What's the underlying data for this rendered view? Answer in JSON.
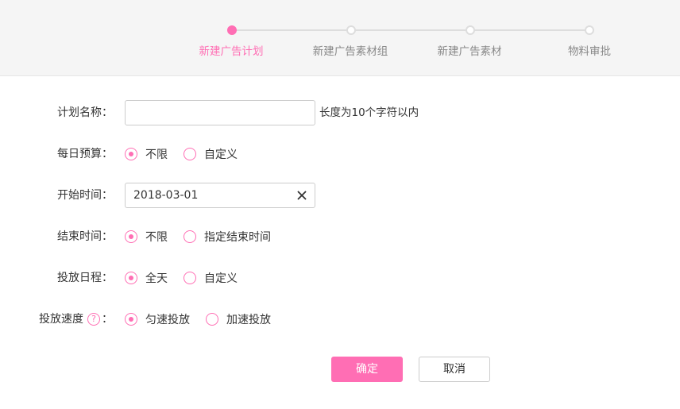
{
  "steps": [
    {
      "label": "新建广告计划",
      "active": true
    },
    {
      "label": "新建广告素材组",
      "active": false
    },
    {
      "label": "新建广告素材",
      "active": false
    },
    {
      "label": "物料审批",
      "active": false
    }
  ],
  "colors": {
    "accent": "#ff6eb4",
    "border": "#cccccc",
    "header_bg": "#f5f5f5"
  },
  "form": {
    "plan_name": {
      "label": "计划名称：",
      "value": "",
      "hint": "长度为10个字符以内"
    },
    "daily_budget": {
      "label": "每日预算：",
      "options": [
        "不限",
        "自定义"
      ],
      "selected": "不限"
    },
    "start_time": {
      "label": "开始时间：",
      "value": "2018-03-01",
      "clear_icon": "close-icon"
    },
    "end_time": {
      "label": "结束时间：",
      "options": [
        "不限",
        "指定结束时间"
      ],
      "selected": "不限"
    },
    "schedule": {
      "label": "投放日程：",
      "options": [
        "全天",
        "自定义"
      ],
      "selected": "全天"
    },
    "speed": {
      "label": "投放速度",
      "help_icon": "?",
      "colon": "：",
      "options": [
        "匀速投放",
        "加速投放"
      ],
      "selected": "匀速投放"
    }
  },
  "buttons": {
    "confirm": "确定",
    "cancel": "取消"
  }
}
